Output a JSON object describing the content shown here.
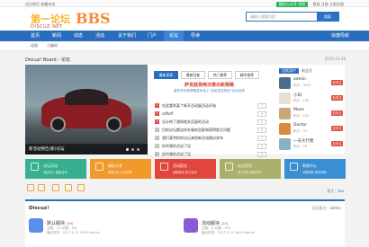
{
  "topbar": {
    "left": "设为首页 收藏本站",
    "wechat": "微信公众号 添加",
    "right": "登录 注册 立即注册"
  },
  "header": {
    "logo_cn": "第一论坛",
    "logo_bbs": "BBS",
    "logo_sub": "DISCUZ.NET",
    "search_placeholder": "请输入搜索内容",
    "search_button": "搜索"
  },
  "nav": {
    "items": [
      "首页",
      "新闻",
      "动态",
      "活动",
      "关于我们",
      "门户",
      "论坛",
      "导读"
    ],
    "quick": "快捷导航"
  },
  "subnav": {
    "items": [
      "动态",
      "二维码"
    ]
  },
  "breadcrumb": "Discuz! Board › 论坛",
  "date": "2015-11-20",
  "slide": {
    "caption": "新活动预告(新)论坛"
  },
  "news": {
    "tabs": [
      "最新发表",
      "最新回复",
      "热门推荐",
      "精华推荐"
    ],
    "headline": "萨克兹将两次推出新策略",
    "subline": "重庆年初新策略发布会上\"全民发帖排名\"论坛总体",
    "rows": [
      {
        "n": "1",
        "t": "在此看到某个新开活动展活动开始",
        "c": "1"
      },
      {
        "n": "2",
        "t": "sdfsdf",
        "c": "0"
      },
      {
        "n": "3",
        "t": "设计修了通知相关页面的活动",
        "c": "2"
      },
      {
        "n": "4",
        "t": "目前论坛都这样办服务回复和获得版主问题",
        "c": "0"
      },
      {
        "n": "5",
        "t": "我们某特别的论坛来把新活动情况发布",
        "c": "1"
      },
      {
        "n": "6",
        "t": "好的我的活动了没",
        "c": "0"
      },
      {
        "n": "7",
        "t": "好约我的活动了没",
        "c": "0"
      }
    ]
  },
  "side": {
    "tabs": [
      "活跃用户",
      "新会员"
    ],
    "users": [
      {
        "name": "admin",
        "info": "积分：3519",
        "badge": "加关注"
      },
      {
        "name": "小白",
        "info": "积分：109",
        "badge": "加关注"
      },
      {
        "name": "Moon",
        "info": "积分：103",
        "badge": "加关注"
      },
      {
        "name": "Doctor",
        "info": "积分：90",
        "badge": "加关注"
      },
      {
        "name": "一天大行者",
        "info": "积分：78",
        "badge": "加关注"
      }
    ]
  },
  "tiles": [
    {
      "title": "论坛活动",
      "sub": "活动中心 最新活动",
      "color": "#37b08f"
    },
    {
      "title": "精彩分享",
      "sub": "资源分享 点击查看",
      "color": "#f09a2c"
    },
    {
      "title": "活动报名",
      "sub": "最新报名 参与活动",
      "color": "#e2453c"
    },
    {
      "title": "站点资讯",
      "sub": "官方发布 最新资讯",
      "color": "#a9b06a"
    },
    {
      "title": "帮助中心",
      "sub": "问题帮助 使用帮助",
      "color": "#3a8fd3"
    }
  ],
  "moderator": {
    "label": "版主：",
    "name": "teo"
  },
  "section": {
    "title": "Discuz!",
    "stat_label": "分区版主：",
    "stat_name": "admin",
    "forums": [
      {
        "name": "默认版块",
        "count": "(56)",
        "stat": "主题：15, 帖数：6万",
        "last": "最后发表：2017-8-12 18:00 admin",
        "color": "#5b8ee6"
      },
      {
        "name": "活动版块",
        "count": "(24)",
        "stat": "主题：6, 帖数：153",
        "last": "最后发表：2017-8-12 18:00 admin",
        "color": "#8a5bd6"
      }
    ]
  }
}
